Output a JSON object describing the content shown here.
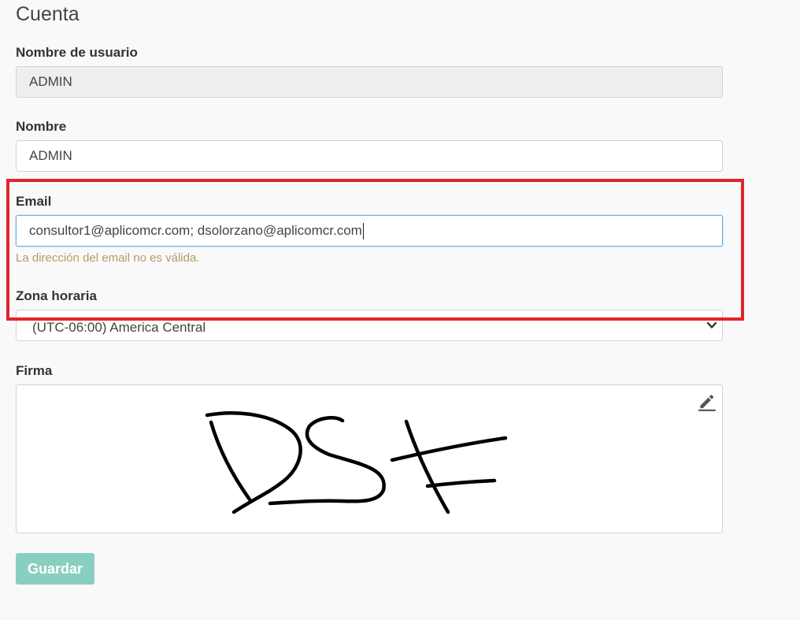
{
  "page": {
    "title": "Cuenta"
  },
  "username": {
    "label": "Nombre de usuario",
    "value": "ADMIN"
  },
  "name": {
    "label": "Nombre",
    "value": "ADMIN"
  },
  "email": {
    "label": "Email",
    "value": "consultor1@aplicomcr.com; dsolorzano@aplicomcr.com",
    "error": "La dirección del email no es válida."
  },
  "timezone": {
    "label": "Zona horaria",
    "selected": "(UTC-06:00) America Central"
  },
  "signature": {
    "label": "Firma",
    "edit_icon": "pencil-icon"
  },
  "save": {
    "label": "Guardar"
  },
  "colors": {
    "highlight": "#e3232b",
    "button": "#89cfc0",
    "error_text": "#b89968",
    "focus_border": "#66afe9"
  }
}
